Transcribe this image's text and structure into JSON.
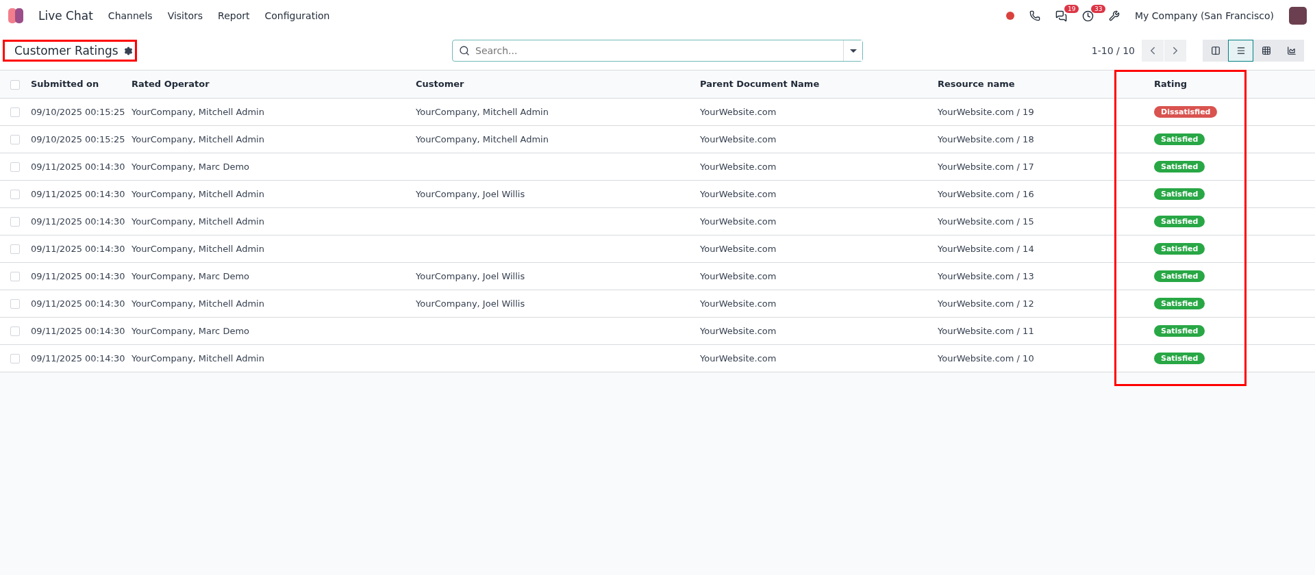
{
  "navbar": {
    "app_name": "Live Chat",
    "menus": [
      "Channels",
      "Visitors",
      "Report",
      "Configuration"
    ],
    "messages_badge": "19",
    "activities_badge": "33",
    "company": "My Company (San Francisco)"
  },
  "control_panel": {
    "title": "Customer Ratings",
    "title_highlighted": true,
    "search": {
      "placeholder": "Search..."
    },
    "pager": "1-10 / 10",
    "views": [
      {
        "kind": "kanban",
        "selected": false
      },
      {
        "kind": "list",
        "selected": true
      },
      {
        "kind": "pivot",
        "selected": false
      },
      {
        "kind": "graph",
        "selected": false
      }
    ]
  },
  "table": {
    "columns": [
      "Submitted on",
      "Rated Operator",
      "Customer",
      "Parent Document Name",
      "Resource name",
      "Rating"
    ],
    "rating_highlighted": true,
    "select_all_checked": false,
    "rows": [
      {
        "checked": false,
        "submitted_on": "09/10/2025 00:15:25",
        "operator": "YourCompany, Mitchell Admin",
        "customer": "YourCompany, Mitchell Admin",
        "parent": "YourWebsite.com",
        "resource": "YourWebsite.com / 19",
        "rating": {
          "kind": "dissatisfied",
          "label": "Dissatisfied"
        }
      },
      {
        "checked": false,
        "submitted_on": "09/10/2025 00:15:25",
        "operator": "YourCompany, Mitchell Admin",
        "customer": "YourCompany, Mitchell Admin",
        "parent": "YourWebsite.com",
        "resource": "YourWebsite.com / 18",
        "rating": {
          "kind": "satisfied",
          "label": "Satisfied"
        }
      },
      {
        "checked": false,
        "submitted_on": "09/11/2025 00:14:30",
        "operator": "YourCompany, Marc Demo",
        "customer": "",
        "parent": "YourWebsite.com",
        "resource": "YourWebsite.com / 17",
        "rating": {
          "kind": "satisfied",
          "label": "Satisfied"
        }
      },
      {
        "checked": false,
        "submitted_on": "09/11/2025 00:14:30",
        "operator": "YourCompany, Mitchell Admin",
        "customer": "YourCompany, Joel Willis",
        "parent": "YourWebsite.com",
        "resource": "YourWebsite.com / 16",
        "rating": {
          "kind": "satisfied",
          "label": "Satisfied"
        }
      },
      {
        "checked": false,
        "submitted_on": "09/11/2025 00:14:30",
        "operator": "YourCompany, Mitchell Admin",
        "customer": "",
        "parent": "YourWebsite.com",
        "resource": "YourWebsite.com / 15",
        "rating": {
          "kind": "satisfied",
          "label": "Satisfied"
        }
      },
      {
        "checked": false,
        "submitted_on": "09/11/2025 00:14:30",
        "operator": "YourCompany, Mitchell Admin",
        "customer": "",
        "parent": "YourWebsite.com",
        "resource": "YourWebsite.com / 14",
        "rating": {
          "kind": "satisfied",
          "label": "Satisfied"
        }
      },
      {
        "checked": false,
        "submitted_on": "09/11/2025 00:14:30",
        "operator": "YourCompany, Marc Demo",
        "customer": "YourCompany, Joel Willis",
        "parent": "YourWebsite.com",
        "resource": "YourWebsite.com / 13",
        "rating": {
          "kind": "satisfied",
          "label": "Satisfied"
        }
      },
      {
        "checked": false,
        "submitted_on": "09/11/2025 00:14:30",
        "operator": "YourCompany, Mitchell Admin",
        "customer": "YourCompany, Joel Willis",
        "parent": "YourWebsite.com",
        "resource": "YourWebsite.com / 12",
        "rating": {
          "kind": "satisfied",
          "label": "Satisfied"
        }
      },
      {
        "checked": false,
        "submitted_on": "09/11/2025 00:14:30",
        "operator": "YourCompany, Marc Demo",
        "customer": "",
        "parent": "YourWebsite.com",
        "resource": "YourWebsite.com / 11",
        "rating": {
          "kind": "satisfied",
          "label": "Satisfied"
        }
      },
      {
        "checked": false,
        "submitted_on": "09/11/2025 00:14:30",
        "operator": "YourCompany, Mitchell Admin",
        "customer": "",
        "parent": "YourWebsite.com",
        "resource": "YourWebsite.com / 10",
        "rating": {
          "kind": "satisfied",
          "label": "Satisfied"
        }
      }
    ]
  }
}
